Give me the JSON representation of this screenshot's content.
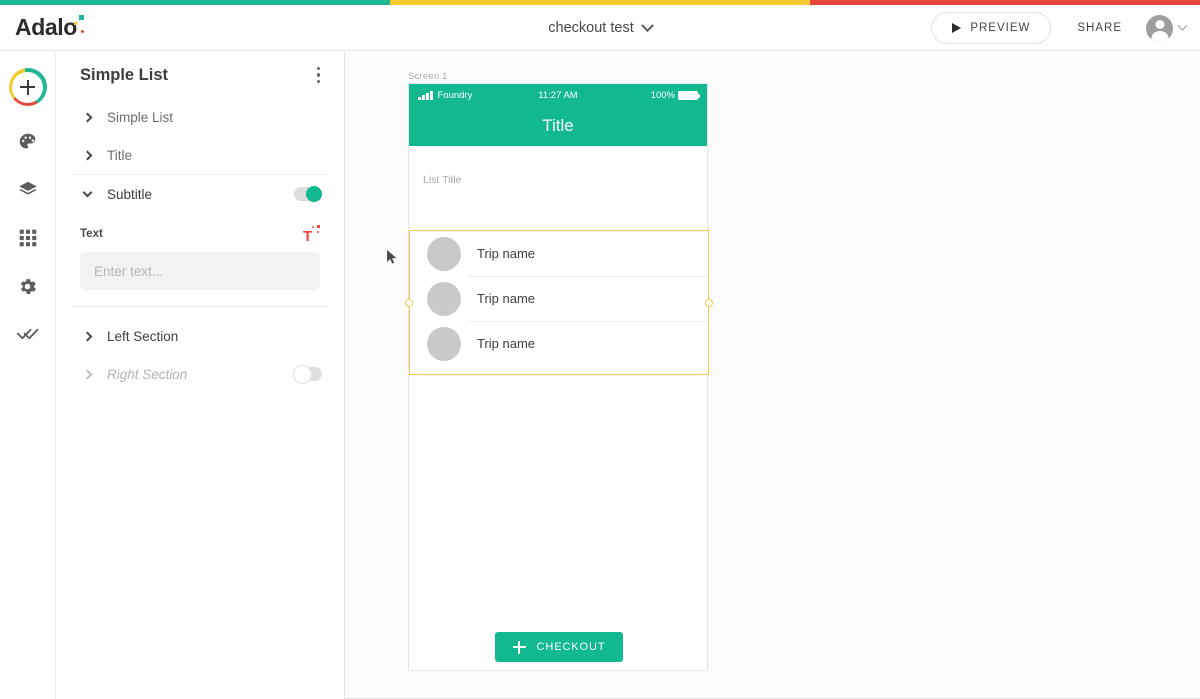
{
  "brand": {
    "logo_text": "Adalo",
    "colors": {
      "teal": "#1fb896",
      "yellow": "#f5cc30",
      "red": "#e8453c",
      "green": "#12b890",
      "selection": "#f0cb4d"
    }
  },
  "topbar": {
    "project_title": "checkout test",
    "dropdown_icon": "chevron-down-icon",
    "preview_label": "PREVIEW",
    "share_label": "SHARE",
    "account_icon": "avatar-icon"
  },
  "rail": {
    "add_icon": "plus-icon",
    "items": [
      {
        "icon": "palette-icon",
        "name": "branding"
      },
      {
        "icon": "layers-icon",
        "name": "screens"
      },
      {
        "icon": "grid-icon",
        "name": "database"
      },
      {
        "icon": "gear-icon",
        "name": "settings"
      },
      {
        "icon": "double-check-icon",
        "name": "publish"
      }
    ]
  },
  "panel": {
    "title": "Simple List",
    "menu_icon": "kebab-menu-icon",
    "rows": [
      {
        "label": "Simple List",
        "state": "collapsed",
        "toggle": null,
        "style": "normal"
      },
      {
        "label": "Title",
        "state": "collapsed",
        "toggle": null,
        "style": "normal"
      },
      {
        "label": "Subtitle",
        "state": "expanded",
        "toggle": "on",
        "style": "dark"
      },
      {
        "label": "Left Section",
        "state": "collapsed",
        "toggle": null,
        "style": "dark"
      },
      {
        "label": "Right Section",
        "state": "collapsed",
        "toggle": "off",
        "style": "italic"
      }
    ],
    "subtitle_field": {
      "label": "Text",
      "magic_icon": "magic-text-icon",
      "value": "",
      "placeholder": "Enter text..."
    }
  },
  "canvas": {
    "screen_label": "Screen 1",
    "phone": {
      "status_bar": {
        "signal_icon": "signal-bars-icon",
        "carrier": "Foundry",
        "time": "11:27 AM",
        "battery_pct": "100%",
        "battery_icon": "battery-full-icon"
      },
      "header_title": "Title",
      "list_title": "List Title",
      "list_items": [
        {
          "avatar": "avatar-placeholder-icon",
          "name": "Trip name"
        },
        {
          "avatar": "avatar-placeholder-icon",
          "name": "Trip name"
        },
        {
          "avatar": "avatar-placeholder-icon",
          "name": "Trip name"
        }
      ],
      "checkout_button": {
        "icon": "plus-icon",
        "label": "CHECKOUT"
      }
    }
  }
}
